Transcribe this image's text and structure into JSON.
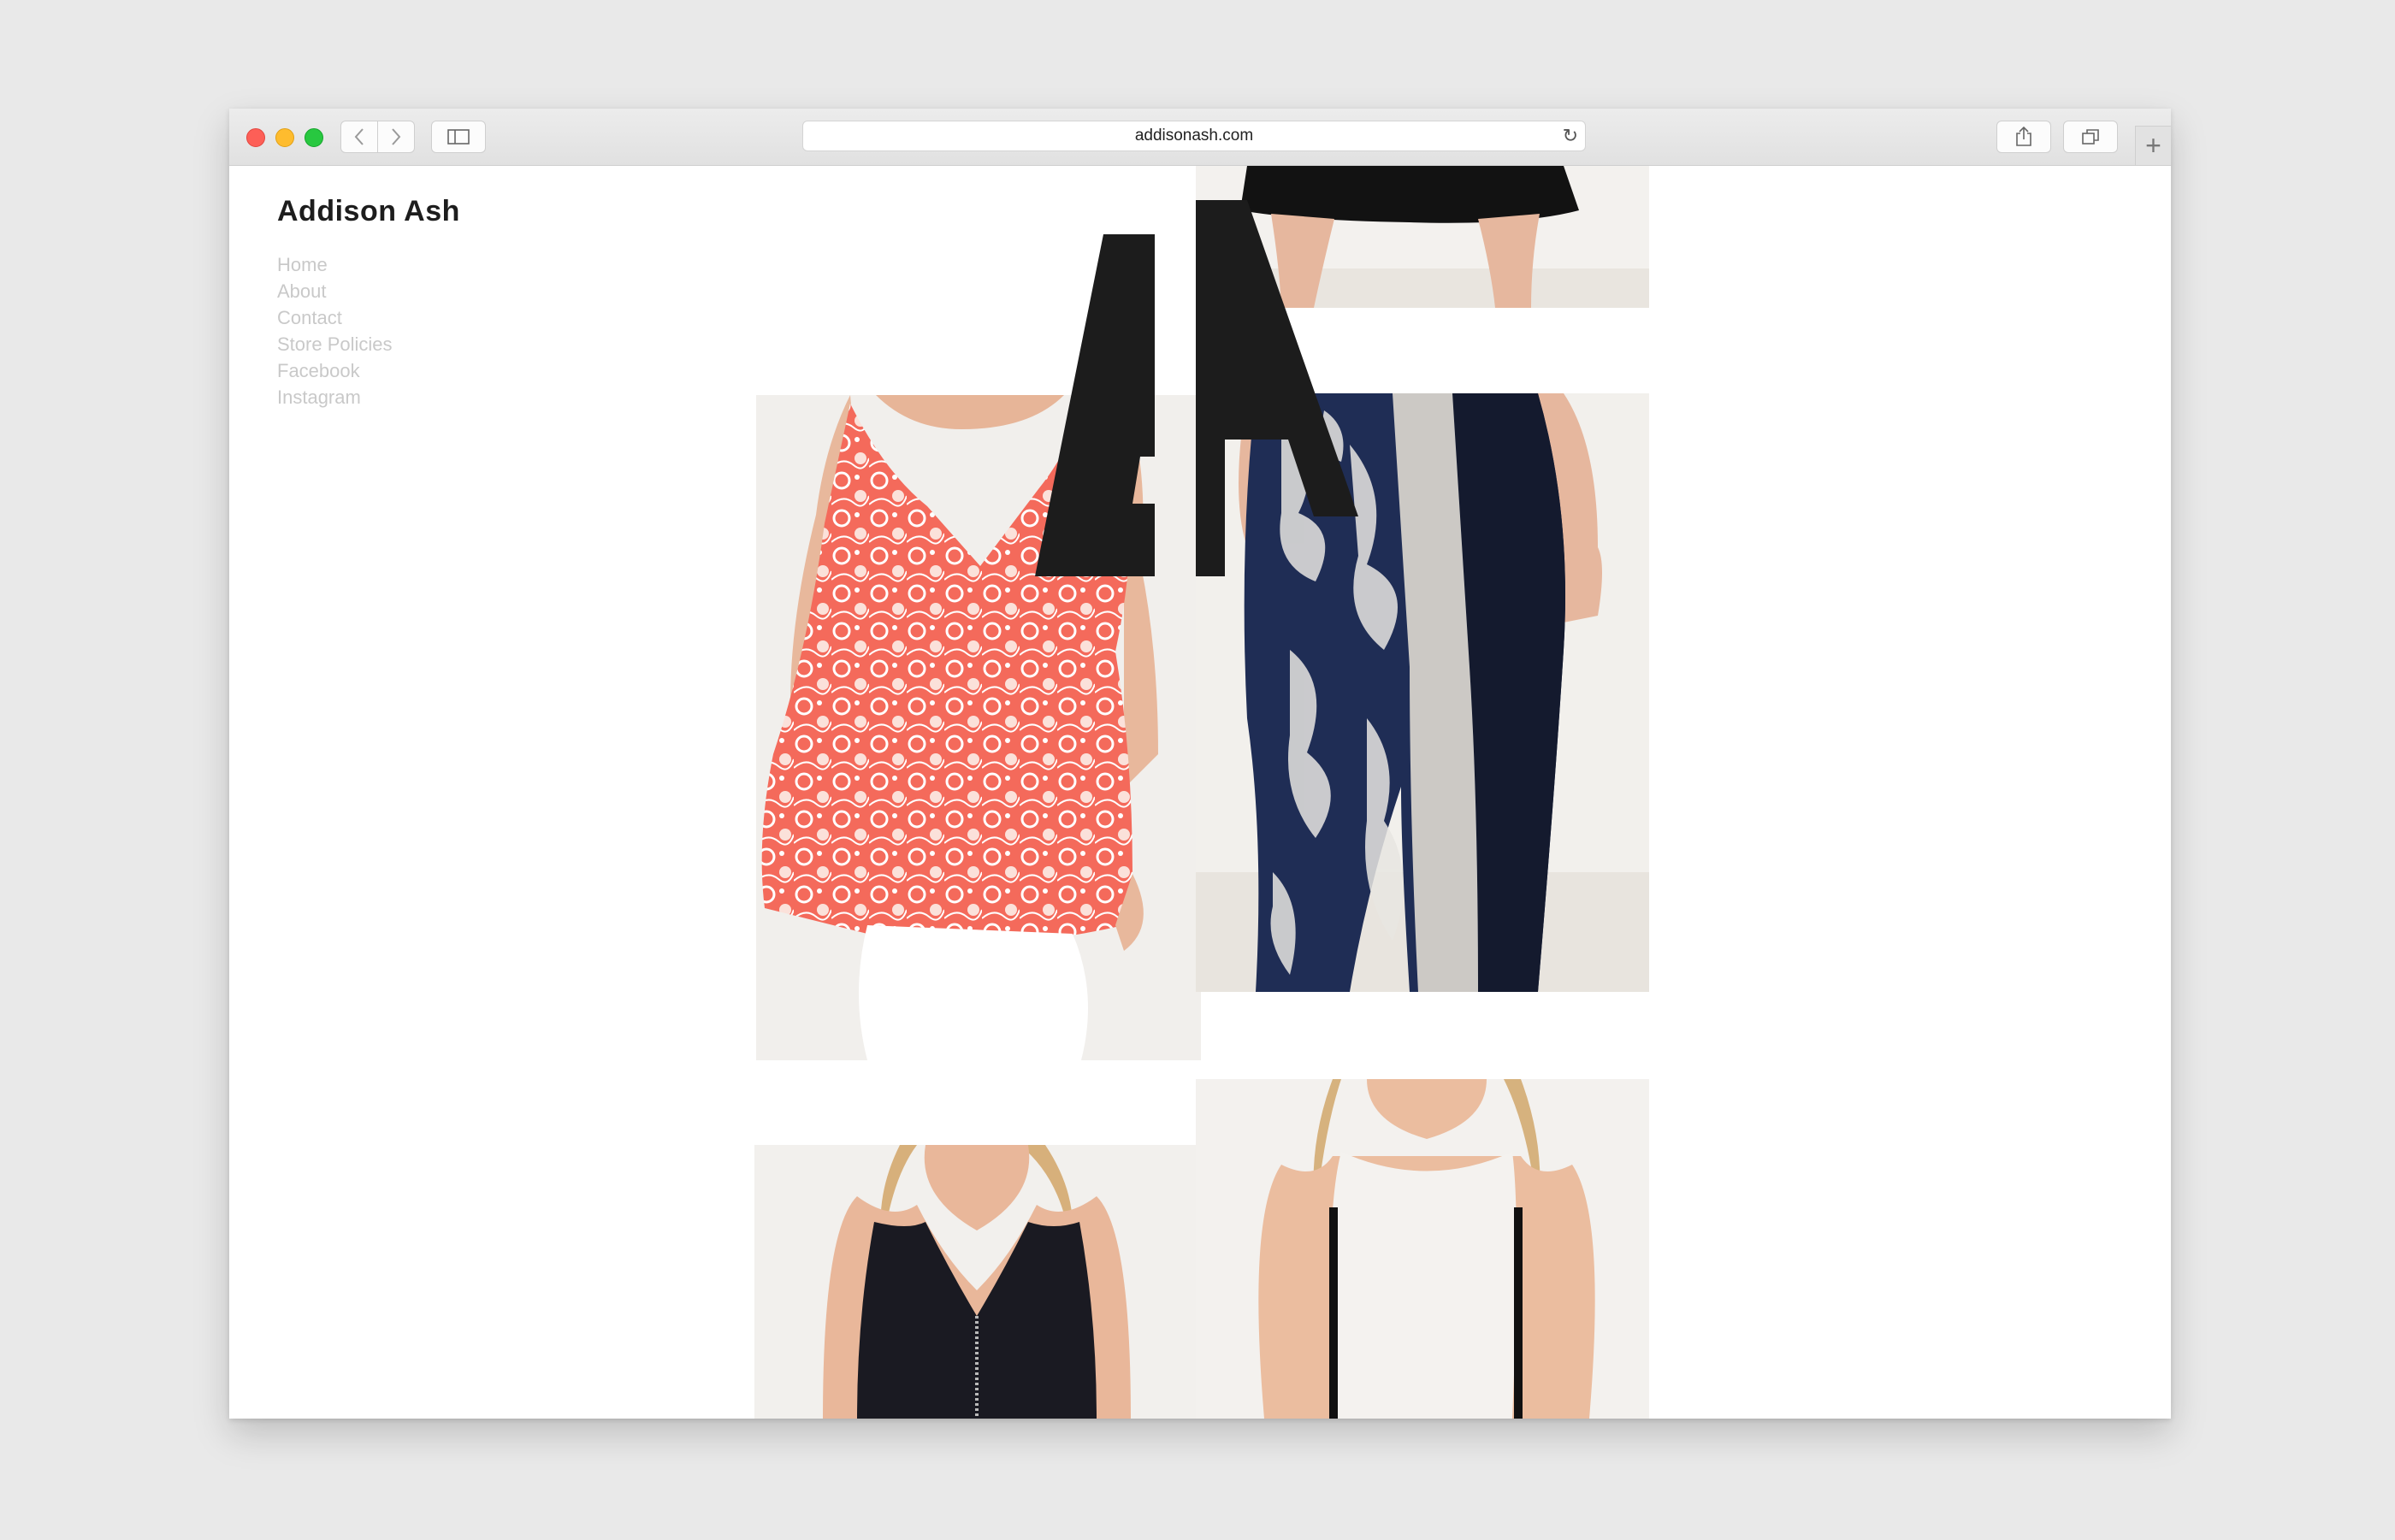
{
  "browser": {
    "url": "addisonash.com",
    "new_tab_symbol": "+",
    "reload_symbol": "↻"
  },
  "site": {
    "brand": "Addison Ash",
    "nav": [
      "Home",
      "About",
      "Contact",
      "Store Policies",
      "Facebook",
      "Instagram"
    ]
  },
  "photos": [
    {
      "name": "black-dress-legs",
      "garment_color": "#111111",
      "skin": "#e6b79e"
    },
    {
      "name": "coral-floral-top",
      "garment_color": "#f26a5c",
      "skin": "#e8b89c"
    },
    {
      "name": "tie-dye-pants",
      "garment_color": "#1f2d55",
      "skin": "#e6b79e"
    },
    {
      "name": "black-zip-top",
      "garment_color": "#1a1a22",
      "skin": "#e9b79a"
    },
    {
      "name": "white-panel-top",
      "garment_color": "#f4f2ef",
      "skin": "#ebbd9f"
    }
  ],
  "colors": {
    "background": "#e9e9e9",
    "brand_text": "#1d1d1d",
    "nav_text": "#c9c9c9",
    "logo": "#1c1c1c"
  }
}
